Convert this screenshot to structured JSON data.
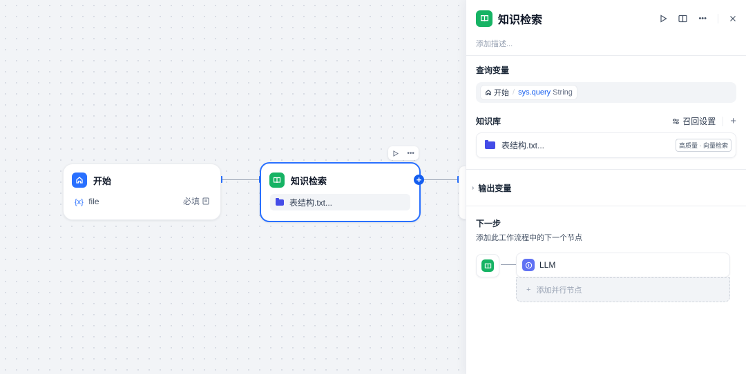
{
  "canvas": {
    "start_node": {
      "title": "开始",
      "icon": "home-icon",
      "variable_prefix": "{x}",
      "variable_name": "file",
      "required_label": "必填"
    },
    "kr_node": {
      "title": "知识检索",
      "icon": "book-icon",
      "file_name": "表结构.txt..."
    },
    "node_toolbar": {
      "run_icon": "play-icon",
      "more_icon": "more-icon"
    },
    "add_handle": "+"
  },
  "panel": {
    "title": "知识检索",
    "description_placeholder": "添加描述...",
    "header_actions": [
      "play-icon",
      "book-open-icon",
      "more-icon",
      "close-icon"
    ],
    "query_section": {
      "label": "查询变量",
      "node_label": "开始",
      "separator": "/",
      "variable": "sys.query",
      "type": "String"
    },
    "knowledge_section": {
      "label": "知识库",
      "recall_settings": "召回设置",
      "add": "+",
      "items": [
        {
          "name": "表结构.txt...",
          "badge": "高质量 · 向量检索"
        }
      ]
    },
    "output_section": {
      "label": "输出变量",
      "chevron": "›"
    },
    "next_step": {
      "title": "下一步",
      "description": "添加此工作流程中的下一个节点",
      "target": "LLM",
      "add_parallel": "添加并行节点",
      "add_plus": "+"
    }
  },
  "colors": {
    "primary": "#2970ff",
    "green": "#16b364",
    "indigo": "#6172f3",
    "folder": "#444ce7"
  }
}
